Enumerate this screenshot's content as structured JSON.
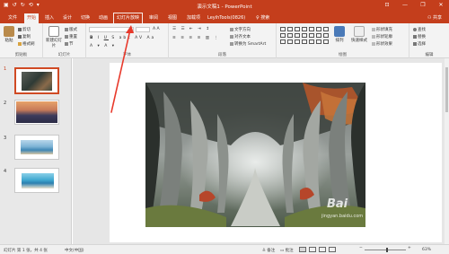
{
  "window": {
    "title": "演示文稿1 - PowerPoint",
    "qat": [
      "↻",
      "↺",
      "⟲",
      "▾"
    ],
    "controls": [
      "⊡",
      "—",
      "❐",
      "✕"
    ]
  },
  "tabs": [
    {
      "label": "文件"
    },
    {
      "label": "开始"
    },
    {
      "label": "插入"
    },
    {
      "label": "设计"
    },
    {
      "label": "切换"
    },
    {
      "label": "动画"
    },
    {
      "label": "幻灯片放映"
    },
    {
      "label": "审阅"
    },
    {
      "label": "视图"
    },
    {
      "label": "加载项"
    },
    {
      "label": "LeyihTools(0826)"
    },
    {
      "label": "搜索"
    }
  ],
  "share_label": "共享",
  "ribbon": {
    "clipboard": {
      "paste": "粘贴",
      "cut": "剪切",
      "copy": "复制",
      "format_painter": "格式刷",
      "group": "剪贴板"
    },
    "slides": {
      "new_slide": "新建幻灯片",
      "layout": "版式",
      "reset": "重置",
      "section": "节",
      "group": "幻灯片"
    },
    "font": {
      "group": "字体"
    },
    "paragraph": {
      "text_direction": "文字方向",
      "align_text": "对齐文本",
      "smartart": "转换为 SmartArt",
      "group": "段落"
    },
    "drawing": {
      "arrange": "排列",
      "quick_styles": "快速样式",
      "shape_fill": "形状填充",
      "shape_outline": "形状轮廓",
      "shape_effects": "形状效果",
      "group": "绘图"
    },
    "editing": {
      "find": "查找",
      "replace": "替换",
      "select": "选择",
      "group": "编辑"
    }
  },
  "thumbnails": [
    {
      "num": "1"
    },
    {
      "num": "2"
    },
    {
      "num": "3"
    },
    {
      "num": "4"
    }
  ],
  "status": {
    "slide_info": "幻灯片 第 1 张，共 4 张",
    "language": "中文(中国)",
    "notes": "备注",
    "comments": "批注",
    "zoom": "63%"
  },
  "watermark": {
    "text": "Bai",
    "sub": "jingyan.baidu.com"
  },
  "colors": {
    "accent": "#c43e1c",
    "annotation": "#e8392b"
  }
}
